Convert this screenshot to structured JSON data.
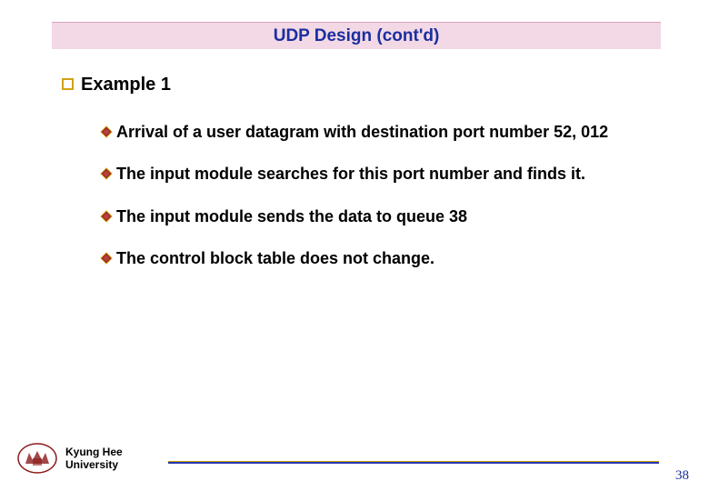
{
  "slide": {
    "title": "UDP Design (cont'd)",
    "heading": "Example 1",
    "bullets": [
      "Arrival of a user datagram with destination port number 52, 012",
      "The input module searches for this port number and finds it.",
      "The input module sends the data to queue 38",
      "The control block table does not change."
    ]
  },
  "footer": {
    "university_line1": "Kyung Hee",
    "university_line2": "University",
    "page_number": "38"
  },
  "colors": {
    "title_bg": "#f3d8e6",
    "title_text": "#1a2f9e",
    "bullet_border": "#d4a017",
    "diamond_fill": "#8b1a1a",
    "footer_line": "#2838b0"
  }
}
